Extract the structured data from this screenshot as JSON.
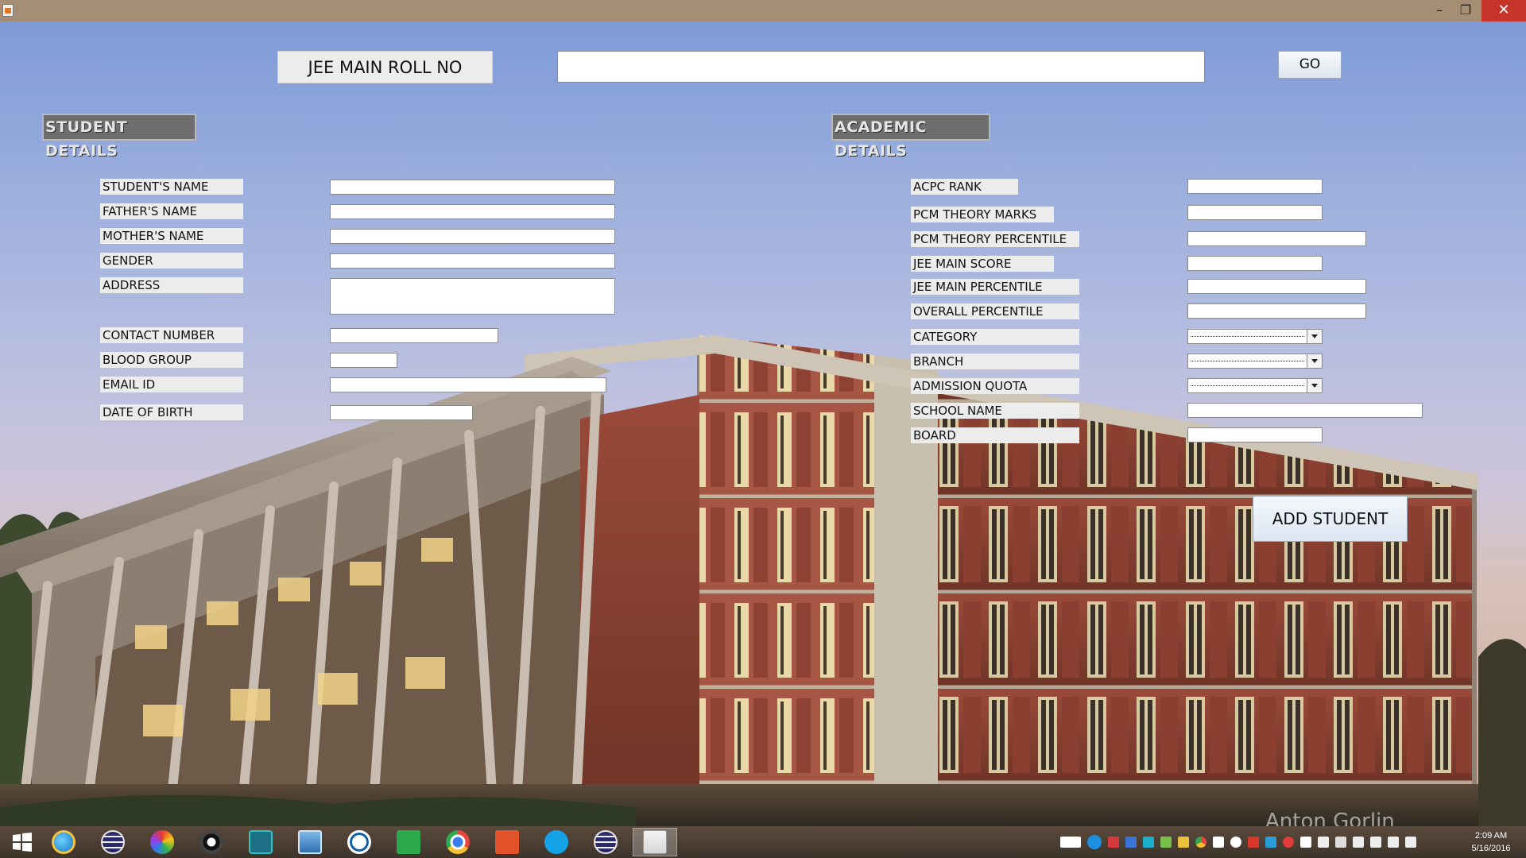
{
  "window": {
    "minimize_glyph": "–",
    "maximize_glyph": "❐",
    "close_glyph": "✕"
  },
  "search": {
    "label": "JEE MAIN ROLL NO",
    "value": "",
    "go_label": "GO"
  },
  "student_section": {
    "title": "STUDENT DETAILS",
    "fields": [
      {
        "label": "STUDENT'S NAME",
        "value": ""
      },
      {
        "label": "FATHER'S NAME",
        "value": ""
      },
      {
        "label": "MOTHER'S NAME",
        "value": ""
      },
      {
        "label": "GENDER",
        "value": ""
      },
      {
        "label": "ADDRESS",
        "value": ""
      },
      {
        "label": "CONTACT NUMBER",
        "value": ""
      },
      {
        "label": "BLOOD GROUP",
        "value": ""
      },
      {
        "label": "EMAIL ID",
        "value": ""
      },
      {
        "label": "DATE OF BIRTH",
        "value": ""
      }
    ]
  },
  "academic_section": {
    "title": "ACADEMIC DETAILS",
    "fields": [
      {
        "label": "ACPC RANK",
        "value": ""
      },
      {
        "label": "PCM THEORY MARKS",
        "value": ""
      },
      {
        "label": "PCM THEORY PERCENTILE",
        "value": ""
      },
      {
        "label": "JEE MAIN SCORE",
        "value": ""
      },
      {
        "label": "JEE MAIN PERCENTILE",
        "value": ""
      },
      {
        "label": "OVERALL PERCENTILE",
        "value": ""
      },
      {
        "label": "CATEGORY",
        "value": ""
      },
      {
        "label": "BRANCH",
        "value": ""
      },
      {
        "label": "ADMISSION QUOTA",
        "value": ""
      },
      {
        "label": "SCHOOL NAME",
        "value": ""
      },
      {
        "label": "BOARD",
        "value": ""
      }
    ],
    "add_button_label": "ADD STUDENT"
  },
  "watermark": "Anton Gorlin",
  "taskbar": {
    "items": [
      "start-icon",
      "internet-explorer-icon",
      "eclipse-icon",
      "media-player-icon",
      "webcam-icon",
      "video-call-icon",
      "remote-desktop-icon",
      "hp-icon",
      "store-icon",
      "chrome-icon",
      "office-icon",
      "skype-icon",
      "eclipse-icon",
      "java-icon"
    ],
    "active_item": "java-icon"
  },
  "clock": {
    "time": "2:09 AM",
    "date": "5/16/2016"
  },
  "colors": {
    "title_bar": "#a58e74",
    "close_button": "#c7352a",
    "section_header": "#6e6e6e",
    "label_bg": "#ececec"
  }
}
